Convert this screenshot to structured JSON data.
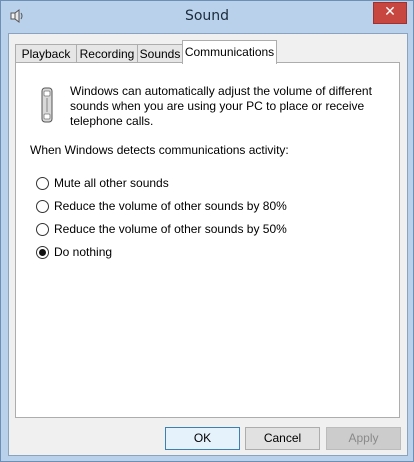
{
  "window": {
    "title": "Sound",
    "close_glyph": "✕",
    "app_icon": "speaker-icon"
  },
  "tabs": [
    {
      "label": "Playback"
    },
    {
      "label": "Recording"
    },
    {
      "label": "Sounds"
    },
    {
      "label": "Communications",
      "active": true
    }
  ],
  "communications": {
    "icon": "telephone-icon",
    "description": "Windows can automatically adjust the volume of different sounds when you are using your PC to place or receive telephone calls.",
    "prompt": "When Windows detects communications activity:",
    "options": [
      {
        "label": "Mute all other sounds",
        "selected": false
      },
      {
        "label": "Reduce the volume of other sounds by 80%",
        "selected": false
      },
      {
        "label": "Reduce the volume of other sounds by 50%",
        "selected": false
      },
      {
        "label": "Do nothing",
        "selected": true
      }
    ]
  },
  "buttons": {
    "ok": "OK",
    "cancel": "Cancel",
    "apply": "Apply"
  },
  "colors": {
    "title_bar": "#b9d1ea",
    "close_button": "#c7463f",
    "panel": "#ffffff",
    "dialog": "#f0f0f0"
  }
}
